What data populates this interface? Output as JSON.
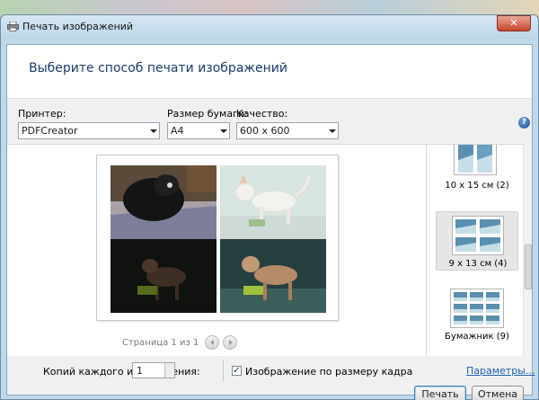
{
  "window": {
    "title": "Печать изображений",
    "close_glyph": "✕"
  },
  "header": {
    "heading": "Выберите способ печати изображений"
  },
  "printer": {
    "label": "Принтер:",
    "value": "PDFCreator"
  },
  "paper": {
    "label": "Размер бумаги:",
    "value": "A4"
  },
  "quality": {
    "label": "Качество:",
    "value": "600 x 600"
  },
  "help_glyph": "?",
  "preview": {
    "pager_text": "Страница 1 из 1"
  },
  "layouts": [
    {
      "name": "10 x 15 см (2)",
      "selected": false
    },
    {
      "name": "9 x 13 см (4)",
      "selected": true
    },
    {
      "name": "Бумажник (9)",
      "selected": false
    }
  ],
  "footer": {
    "copies_label": "Копий каждого изображения:",
    "copies_value": "1",
    "fit_checked": true,
    "check_glyph": "✓",
    "fit_label": "Изображение по размеру кадра",
    "options_link": "Параметры...",
    "print_button": "Печать",
    "cancel_button": "Отмена"
  },
  "icons": [
    "printer-icon",
    "close-icon",
    "help-icon",
    "chevron-left-icon",
    "chevron-right-icon",
    "dropdown-arrow-icon"
  ]
}
